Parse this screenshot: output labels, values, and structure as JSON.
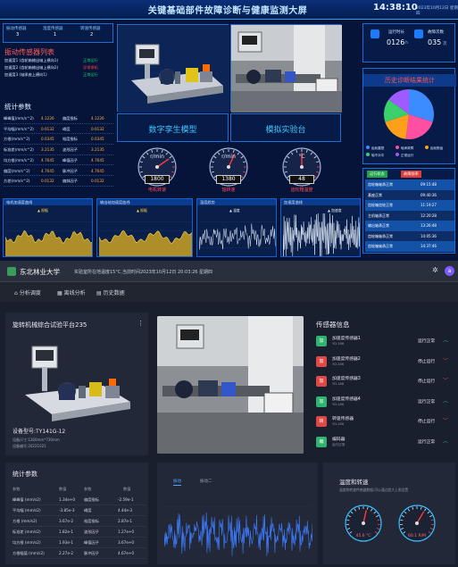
{
  "top": {
    "title": "关键基础部件故障诊断与健康监测大屏",
    "clock": "14:38:10",
    "date": "2023年10月12日 星期四",
    "counters": [
      {
        "label": "振动传感器",
        "value": "3"
      },
      {
        "label": "温度传感器",
        "value": "1"
      },
      {
        "label": "转速传感器",
        "value": "2"
      }
    ],
    "sensor_list_title": "振动传感器列表",
    "sensors": [
      {
        "name": "加速度1 (齿轮箱输出轴上横向1)",
        "status": "正常运行",
        "color": "#19d36b"
      },
      {
        "name": "加速度2 (齿轮箱输出轴上横向2)",
        "status": "异常停机",
        "color": "#ff4040"
      },
      {
        "name": "加速度3 (轴承座上横向1)",
        "status": "正常运行",
        "color": "#19d36b"
      }
    ],
    "stats_title": "统计参数",
    "stats": [
      {
        "k1": "峰峰值(mm/s^2)",
        "v1": "4.1226",
        "k2": "偏度指标",
        "v2": "4.1226"
      },
      {
        "k1": "平均幅(mm/s^2)",
        "v1": "0.0132",
        "k2": "峭度",
        "v2": "0.0132"
      },
      {
        "k1": "方根(mm/s^2)",
        "v1": "0.0345",
        "k2": "裕度指标",
        "v2": "0.0345"
      },
      {
        "k1": "标准差(mm/s^2)",
        "v1": "3.2135",
        "k2": "波形因子",
        "v2": "3.2135"
      },
      {
        "k1": "均方根(mm/s^2)",
        "v1": "4.7645",
        "k2": "峰值因子",
        "v2": "4.7645"
      },
      {
        "k1": "偏度(mm/s^2)",
        "v1": "4.7645",
        "k2": "脉冲因子",
        "v2": "4.7645"
      },
      {
        "k1": "方差(mm/s^2)",
        "v1": "0.0132",
        "k2": "偏斜因子",
        "v2": "0.0132"
      }
    ],
    "twin_label": "数字孪生模型",
    "lab_label": "模拟实验台",
    "gauges": [
      {
        "unit": "r/min",
        "value": "1800",
        "label": "电机转速",
        "level": 0.72
      },
      {
        "unit": "r/min",
        "value": "1380",
        "label": "轴转速",
        "level": 0.6
      },
      {
        "unit": "°C",
        "value": "48",
        "label": "齿轮箱温度",
        "level": 0.5
      }
    ],
    "kpis": [
      {
        "label": "运行时长",
        "value": "0126",
        "unit": "h"
      },
      {
        "label": "故障次数",
        "value": "035",
        "unit": "次"
      }
    ],
    "diag_title": "历史诊断结果统计",
    "pie": {
      "values": [
        30,
        22,
        18,
        15,
        15
      ],
      "colors": [
        "#3c8cff",
        "#ff4fa3",
        "#ff9f1a",
        "#3ad06b",
        "#9e5cff"
      ]
    },
    "legend": [
      "齿轮磨损",
      "轴承故障",
      "齿轮断齿",
      "轴不对中",
      "正常运行"
    ],
    "table_headers": [
      "运行状态",
      "故障频率"
    ],
    "table_rows": [
      {
        "status": "齿轮箱轴承正常",
        "time": "09:15:48"
      },
      {
        "status": "基座正常",
        "time": "09:40:36"
      },
      {
        "status": "齿轮箱齿轮正常",
        "time": "11:19:27"
      },
      {
        "status": "主机轴承正常",
        "time": "12:20:28"
      },
      {
        "status": "输出轴承正常",
        "time": "13:26:48"
      },
      {
        "status": "齿轮箱轴承正常",
        "time": "14:05:36"
      },
      {
        "status": "齿轮箱轴承正常",
        "time": "14:37:46"
      }
    ],
    "charts": [
      {
        "title": "电机加速度曲线",
        "legend": "振幅"
      },
      {
        "title": "输出轴加速度曲线",
        "legend": "振幅"
      },
      {
        "title": "温度趋势",
        "legend": "温度"
      },
      {
        "title": "加速度曲线",
        "legend": "加速度"
      }
    ]
  },
  "bottom": {
    "brand": "东北林业大学",
    "info": "实验室所在地温度15°C,当前时间2023年10月12日 20:03:26 星期四",
    "tabs": [
      "分析调度",
      "离线分析",
      "历史数据"
    ],
    "rig_title": "旋转机械综合试验平台235",
    "model": "设备型号:TY141G-12",
    "size": "设备尺寸:1260mm*730mm",
    "date": "设备编号:20221021",
    "sensor_title": "传感器信息",
    "sensors": [
      {
        "name": "加速度传感器1",
        "sub": "YD-186",
        "status": "运行正常",
        "badge": "加",
        "color": "#2fb36f"
      },
      {
        "name": "加速度传感器2",
        "sub": "YD-186",
        "status": "停止运行",
        "badge": "加",
        "color": "#e04848"
      },
      {
        "name": "加速度传感器3",
        "sub": "YD-186",
        "status": "停止运行",
        "badge": "加",
        "color": "#e04848"
      },
      {
        "name": "加速度传感器4",
        "sub": "YD-186",
        "status": "运行正常",
        "badge": "加",
        "color": "#2fb36f"
      },
      {
        "name": "转速传感器",
        "sub": "YD-186",
        "status": "停止运行",
        "badge": "转",
        "color": "#e04848"
      },
      {
        "name": "编码器",
        "sub": "运行正常",
        "status": "运行正常",
        "badge": "编",
        "color": "#2fb36f"
      }
    ],
    "stats_title": "统计参数",
    "stats_headers": [
      "参数",
      "数值",
      "参数",
      "数值"
    ],
    "stats": [
      {
        "k1": "峰峰值 (mm/s2)",
        "v1": "1.34e+0",
        "k2": "偏度指标",
        "v2": "-2.59e-1"
      },
      {
        "k1": "平均幅 (mm/s2)",
        "v1": "-3.85e-3",
        "k2": "峭度",
        "v2": "4.44e-3"
      },
      {
        "k1": "方根 (mm/s2)",
        "v1": "3.67e-2",
        "k2": "裕度指标",
        "v2": "2.87e-1"
      },
      {
        "k1": "标准差 (mm/s2)",
        "v1": "1.82e-1",
        "k2": "波形因子",
        "v2": "1.27e+0"
      },
      {
        "k1": "均方根 (mm/s2)",
        "v1": "1.93e-1",
        "k2": "峰值因子",
        "v2": "3.67e+0"
      },
      {
        "k1": "方根幅值 (mm/s2)",
        "v1": "2.27e-2",
        "k2": "脉冲因子",
        "v2": "4.67e+0"
      }
    ],
    "wave_tabs": [
      "振动",
      "振动二"
    ],
    "temp_title": "温度和转速",
    "temp_sub": "温度和转速传感器数据/可以通过超大上限设置",
    "gauges": [
      {
        "value": "45.6 °C",
        "level": 0.55
      },
      {
        "value": "60.1 R/M",
        "level": 0.62
      }
    ]
  }
}
